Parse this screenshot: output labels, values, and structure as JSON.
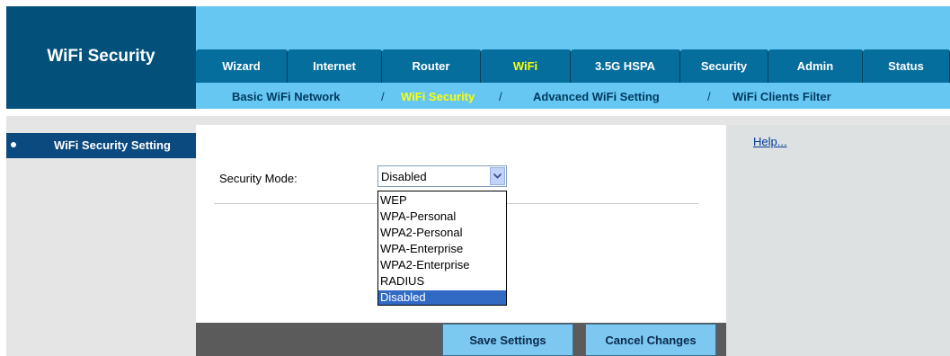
{
  "header": {
    "title": "WiFi Security"
  },
  "tabs": [
    {
      "label": "Wizard",
      "active": false
    },
    {
      "label": "Internet",
      "active": false
    },
    {
      "label": "Router",
      "active": false
    },
    {
      "label": "WiFi",
      "active": true
    },
    {
      "label": "3.5G HSPA",
      "active": false
    },
    {
      "label": "Security",
      "active": false
    },
    {
      "label": "Admin",
      "active": false
    },
    {
      "label": "Status",
      "active": false
    }
  ],
  "subnav": [
    {
      "label": "Basic WiFi Network",
      "active": false
    },
    {
      "label": "WiFi Security",
      "active": true
    },
    {
      "label": "Advanced WiFi Setting",
      "active": false
    },
    {
      "label": "WiFi Clients Filter",
      "active": false
    }
  ],
  "subnav_separator": "/",
  "sidebar": {
    "items": [
      {
        "label": "WiFi Security Setting",
        "active": true
      }
    ]
  },
  "form": {
    "security_mode_label": "Security Mode:",
    "security_mode_value": "Disabled",
    "options": [
      "WEP",
      "WPA-Personal",
      "WPA2-Personal",
      "WPA-Enterprise",
      "WPA2-Enterprise",
      "RADIUS",
      "Disabled"
    ],
    "selected_option": "Disabled"
  },
  "help": {
    "label": "Help..."
  },
  "buttons": {
    "save": "Save Settings",
    "cancel": "Cancel Changes"
  },
  "colors": {
    "title_block": "#03507b",
    "band": "#66c7f3",
    "tab": "#066e9d",
    "active_text": "#ffff00",
    "button": "#7cc8f1"
  }
}
